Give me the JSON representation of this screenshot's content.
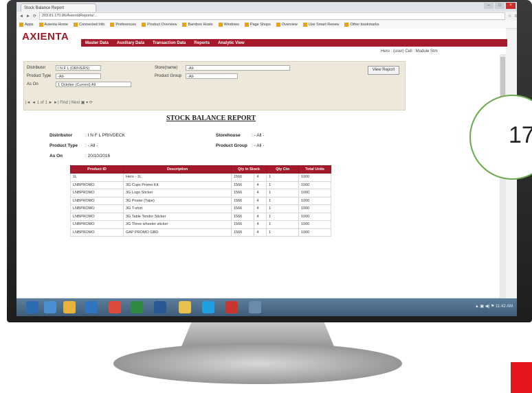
{
  "badge": {
    "number": "17"
  },
  "browser": {
    "tab_title": "Stock Balance Report",
    "address": "203.81.170.86/AxientaReports/...",
    "window_buttons": [
      "–",
      "□",
      "×"
    ],
    "bookmarks": [
      "Apps",
      "Axienta Home",
      "Connected Info",
      "Preferences",
      "Product Overview",
      "Bamboo Hosts",
      "Windows",
      "Page Shops",
      "Overview",
      "Use Smart Renew",
      "Other bookmarks"
    ]
  },
  "app": {
    "logo": "AXIENTA",
    "nav": [
      "Master Data",
      "Auxiliary Data",
      "Transaction Data",
      "Reports",
      "Analytic View"
    ],
    "user_line": "Hero : (user)   Cell : Module Stm"
  },
  "filters": {
    "distributor_label": "Distributor",
    "distributor_value": "I N F L (ORIVERS)",
    "store_label": "Store(name)",
    "store_value": "-All-",
    "product_type_label": "Product Type",
    "product_type_value": "-All-",
    "product_group_label": "Product Group",
    "product_group_value": "-All-",
    "as_on_label": "As On",
    "as_on_value": "1 October (Current) All",
    "view_button": "View Report",
    "pager": "|◄  ◄  1  of 1  ►  ►|     Find | Next     ▣ ▾  ⟳"
  },
  "report": {
    "title": "STOCK BALANCE REPORT",
    "distributor_label": "Distributor",
    "distributor_value": ": I N F L PRIVDECK",
    "store_label": "Storehouse",
    "store_value": ": - All -",
    "product_type_label": "Product Type",
    "product_type_value": ": - All -",
    "product_group_label": "Product Group",
    "product_group_value": ": - All -",
    "as_on_label": "As On",
    "as_on_value": ": 20/10/2016",
    "columns": [
      "Product ID",
      "Description",
      "Qty In Stock",
      "Qty Ctn",
      "Total Units"
    ],
    "rows": [
      [
        "1L",
        "Hero - 1L",
        "1566",
        "4",
        "1",
        "1000"
      ],
      [
        "LNBPROMO",
        "3G Cups Promo Kit",
        "1566",
        "4",
        "1",
        "1000"
      ],
      [
        "LNBPROMO",
        "3G Logo Sticker",
        "1566",
        "4",
        "1",
        "1000"
      ],
      [
        "LNBPROMO",
        "3G Poster (Tape)",
        "1566",
        "4",
        "1",
        "1000"
      ],
      [
        "LNBPROMO",
        "3G T-shirt",
        "1566",
        "4",
        "1",
        "1000"
      ],
      [
        "LNBPROMO",
        "3G Table Tendor Sticker",
        "1566",
        "4",
        "1",
        "1000"
      ],
      [
        "LNBPROMO",
        "3G Three wheeler sticker",
        "1566",
        "4",
        "1",
        "1000"
      ],
      [
        "LNBPROMO",
        "GAP PROMO GBD",
        "1566",
        "4",
        "1",
        "1000"
      ]
    ]
  },
  "taskbar": {
    "tray_text": "▲ ▣ ◀) ⚑  11:42 AM"
  }
}
